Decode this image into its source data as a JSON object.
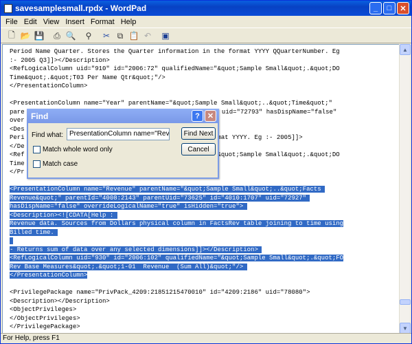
{
  "window": {
    "title": "savesamplesmall.rpdx - WordPad"
  },
  "menu": [
    "File",
    "Edit",
    "View",
    "Insert",
    "Format",
    "Help"
  ],
  "toolbar": [
    "new-icon",
    "open-icon",
    "save-icon",
    "print-icon",
    "print-preview-icon",
    "find-icon",
    "cut-icon",
    "copy-icon",
    "paste-icon",
    "undo-icon",
    "insert-object-icon"
  ],
  "document": {
    "lines": [
      {
        "text": "Period Name Quarter. Stores the Quarter information in the format YYYY QQuarterNumber. Eg"
      },
      {
        "text": ":- 2005 Q3]]></Description>"
      },
      {
        "text": "<RefLogicalColumn uid=\"910\" id=\"2006:72\" qualifiedName=\"&quot;Sample Small&quot;.&quot;DO"
      },
      {
        "text": "Time&quot;.&quot;T03 Per Name Qtr&quot;\"/>"
      },
      {
        "text": "</PresentationColumn>"
      },
      {
        "text": ""
      },
      {
        "text": "<PresentationColumn name=\"Year\" parentName=\"&quot;Sample Small&quot;..&quot;Time&quot;\""
      },
      {
        "text": "pare",
        "right": "685\" uid=\"72793\" hasDispName=\"false\""
      },
      {
        "text": "over"
      },
      {
        "text": "<Des"
      },
      {
        "text": "Peri",
        "right": "the format YYYY. Eg :- 2005]]>"
      },
      {
        "text": "</De"
      },
      {
        "text": "<Ref",
        "right": "dName=\"&quot;Sample Small&quot;.&quot;DO"
      },
      {
        "text": "Time"
      },
      {
        "text": "</Pr"
      },
      {
        "text": ""
      },
      {
        "text": "<PresentationColumn name=\"Revenue\" parentName=\"&quot;Sample Small&quot;..&quot;Facts ",
        "selected": true
      },
      {
        "text": "Revenue&quot;\" parentId=\"4008:2143\" parentUid=\"73625\" id=\"4010:1707\" uid=\"72927\" ",
        "selected": true
      },
      {
        "text": "hasDispName=\"false\" overrideLogicalName=\"true\" isHidden=\"true\"> ",
        "selected": true
      },
      {
        "text": "<Description><![CDATA[Help : ",
        "selected": true
      },
      {
        "text": "Revenue data. Sources from Dollars physical column in FactsRev table joining to time using",
        "selected": true
      },
      {
        "text": "Billed time. ",
        "selected": true
      },
      {
        "text": " ",
        "selected": true
      },
      {
        "text": "- Returns sum of data over any selected dimensions]]></Description> ",
        "selected": true
      },
      {
        "text": "<RefLogicalColumn uid=\"930\" id=\"2006:102\" qualifiedName=\"&quot;Sample Small&quot;.&quot;FO",
        "selected": true
      },
      {
        "text": "Rev Base Measures&quot;.&quot;1-01  Revenue  (Sum All)&quot;\"/> ",
        "selected": true
      },
      {
        "text": "</PresentationColumn>",
        "selected": true
      },
      {
        "text": ""
      },
      {
        "text": "<PrivilegePackage name=\"PrivPack_4209:21851215470010\" id=\"4209:2186\" uid=\"78080\">"
      },
      {
        "text": "<Description></Description>"
      },
      {
        "text": "<ObjectPrivileges>"
      },
      {
        "text": "</ObjectPrivileges>"
      },
      {
        "text": "</PrivilegePackage>"
      }
    ]
  },
  "find_dialog": {
    "title": "Find",
    "find_what_label": "Find what:",
    "find_what_value": "PresentationColumn name=\"Revenue\"",
    "find_next": "Find Next",
    "cancel": "Cancel",
    "match_whole_word": "Match whole word only",
    "match_case": "Match case",
    "help": "?",
    "close": "✕"
  },
  "status": "For Help, press F1",
  "colors": {
    "selection": "#316ac5",
    "titlebar": "#0a5fe0"
  }
}
